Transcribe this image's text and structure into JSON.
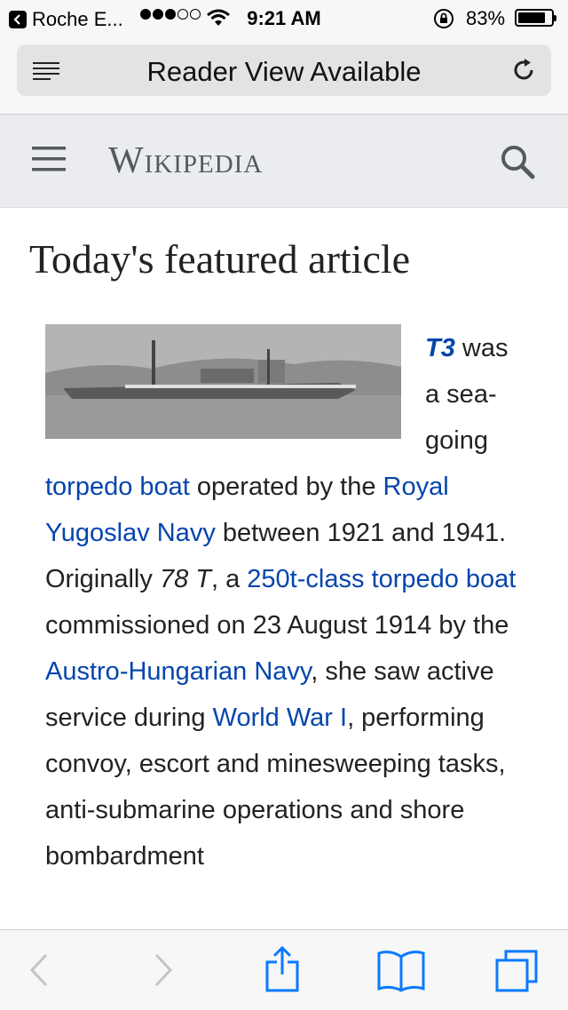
{
  "status": {
    "back_app": "Roche E...",
    "time": "9:21 AM",
    "battery_pct": "83%",
    "battery_level": 0.83,
    "signal_bars_filled": 3,
    "signal_bars_total": 5
  },
  "browser": {
    "url_text": "Reader View Available",
    "icons": [
      "reader-icon",
      "reload-icon"
    ]
  },
  "wiki": {
    "wordmark": "Wikipedia",
    "icons": [
      "menu-icon",
      "search-icon"
    ]
  },
  "article": {
    "heading": "Today's featured article",
    "image_alt": "torpedo boat photo",
    "t3": "T3",
    "s1": " was a sea-going ",
    "link_torpedo_boat": "torpedo boat",
    "s2": " operated by the ",
    "link_royal_yugoslav_navy": "Royal Yugoslav Navy",
    "s3": " between 1921 and 1941. Originally ",
    "italic_78t": "78 T",
    "s4": ", a ",
    "link_250t": "250t-class torpedo boat",
    "s5": " commissioned on 23 August 1914 by the ",
    "link_austro": "Austro-Hungarian Navy",
    "s6": ", she saw active service during ",
    "link_ww1": "World War I",
    "s7": ", performing convoy, escort and minesweeping tasks, anti-submarine operations and shore bombardment"
  },
  "toolbar": {
    "icons": [
      "back-icon",
      "forward-icon",
      "share-icon",
      "bookmarks-icon",
      "tabs-icon"
    ]
  },
  "colors": {
    "link": "#0645ad",
    "ios_blue": "#0a7aff",
    "header_bg": "#eaecf0"
  }
}
